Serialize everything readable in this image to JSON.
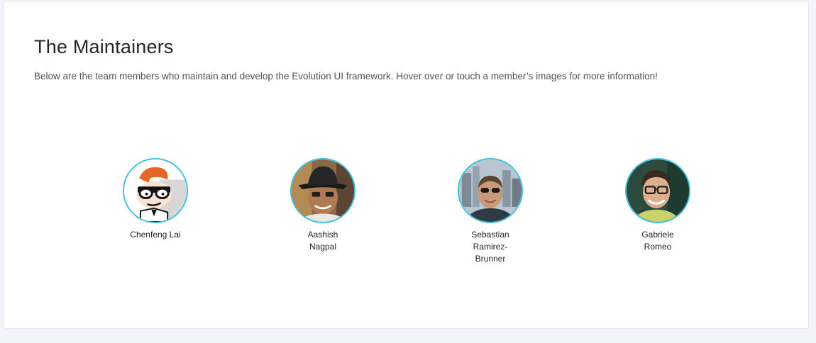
{
  "section": {
    "title": "The Maintainers",
    "description": "Below are the team members who maintain and develop the Evolution UI framework. Hover over or touch a member’s images for more information!"
  },
  "members": [
    {
      "name": "Chenfeng Lai",
      "avatar": "cartoon-scientist-avatar"
    },
    {
      "name": "Aashish Nagpal",
      "avatar": "photo-avatar-hat-glasses"
    },
    {
      "name": "Sebastian Ramirez-Brunner",
      "avatar": "photo-avatar-sunglasses-city"
    },
    {
      "name": "Gabriele Romeo",
      "avatar": "photo-avatar-glasses-smiling"
    }
  ],
  "colors": {
    "background": "#f3f4f9",
    "card": "#ffffff",
    "avatar_ring": "#3fc0e0",
    "text": "#222629"
  }
}
